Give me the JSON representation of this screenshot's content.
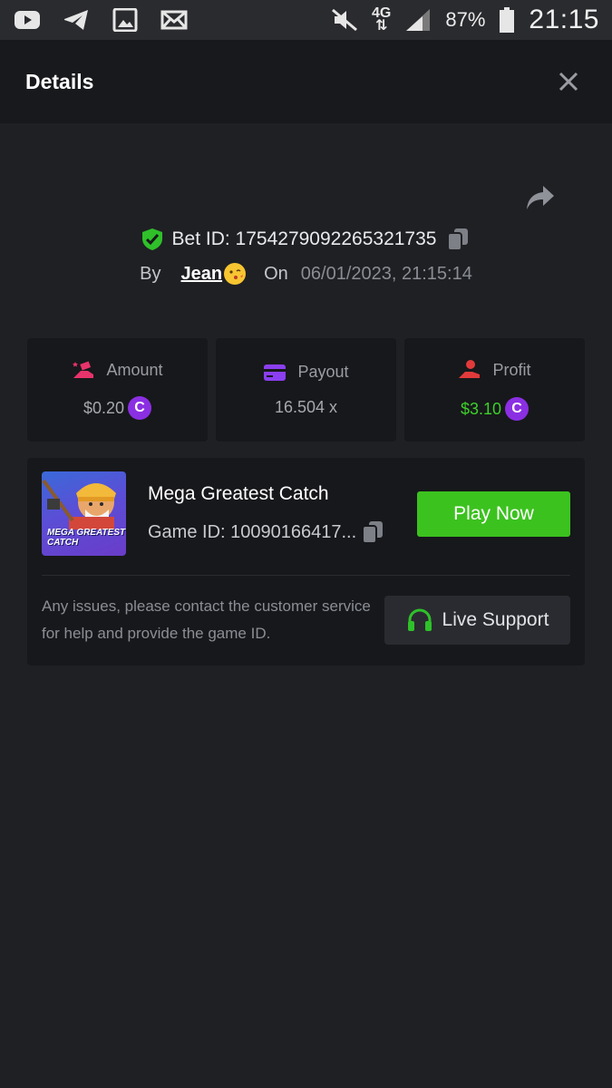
{
  "status_bar": {
    "battery": "87%",
    "time": "21:15",
    "network": "4G"
  },
  "header": {
    "title": "Details"
  },
  "bet": {
    "id": "Bet ID: 1754279092265321735",
    "by_label": "By",
    "user": "Jean",
    "on_label": "On",
    "date": "06/01/2023, 21:15:14"
  },
  "stats": [
    {
      "label": "Amount",
      "value": "$0.20",
      "icon": "money-hand-icon",
      "icon_color": "#e8336b",
      "coin": "C"
    },
    {
      "label": "Payout",
      "value": "16.504 x",
      "icon": "card-icon",
      "icon_color": "#8a3ff0"
    },
    {
      "label": "Profit",
      "value": "$3.10",
      "icon": "hand-coin-icon",
      "icon_color": "#e23a3a",
      "coin": "C",
      "value_color": "#3dd02a"
    }
  ],
  "game": {
    "thumb_text": "MEGA GREATEST CATCH",
    "title": "Mega Greatest Catch",
    "game_id": "Game ID: 10090166417...",
    "play_label": "Play Now"
  },
  "support": {
    "help_text": "Any issues, please contact the customer service for help and provide the game ID.",
    "button_label": "Live Support"
  },
  "colors": {
    "background": "#1f2024",
    "header": "#18191c",
    "card": "#17181b",
    "accent_green": "#3cc21f",
    "coin_purple": "#8b2fe3"
  }
}
